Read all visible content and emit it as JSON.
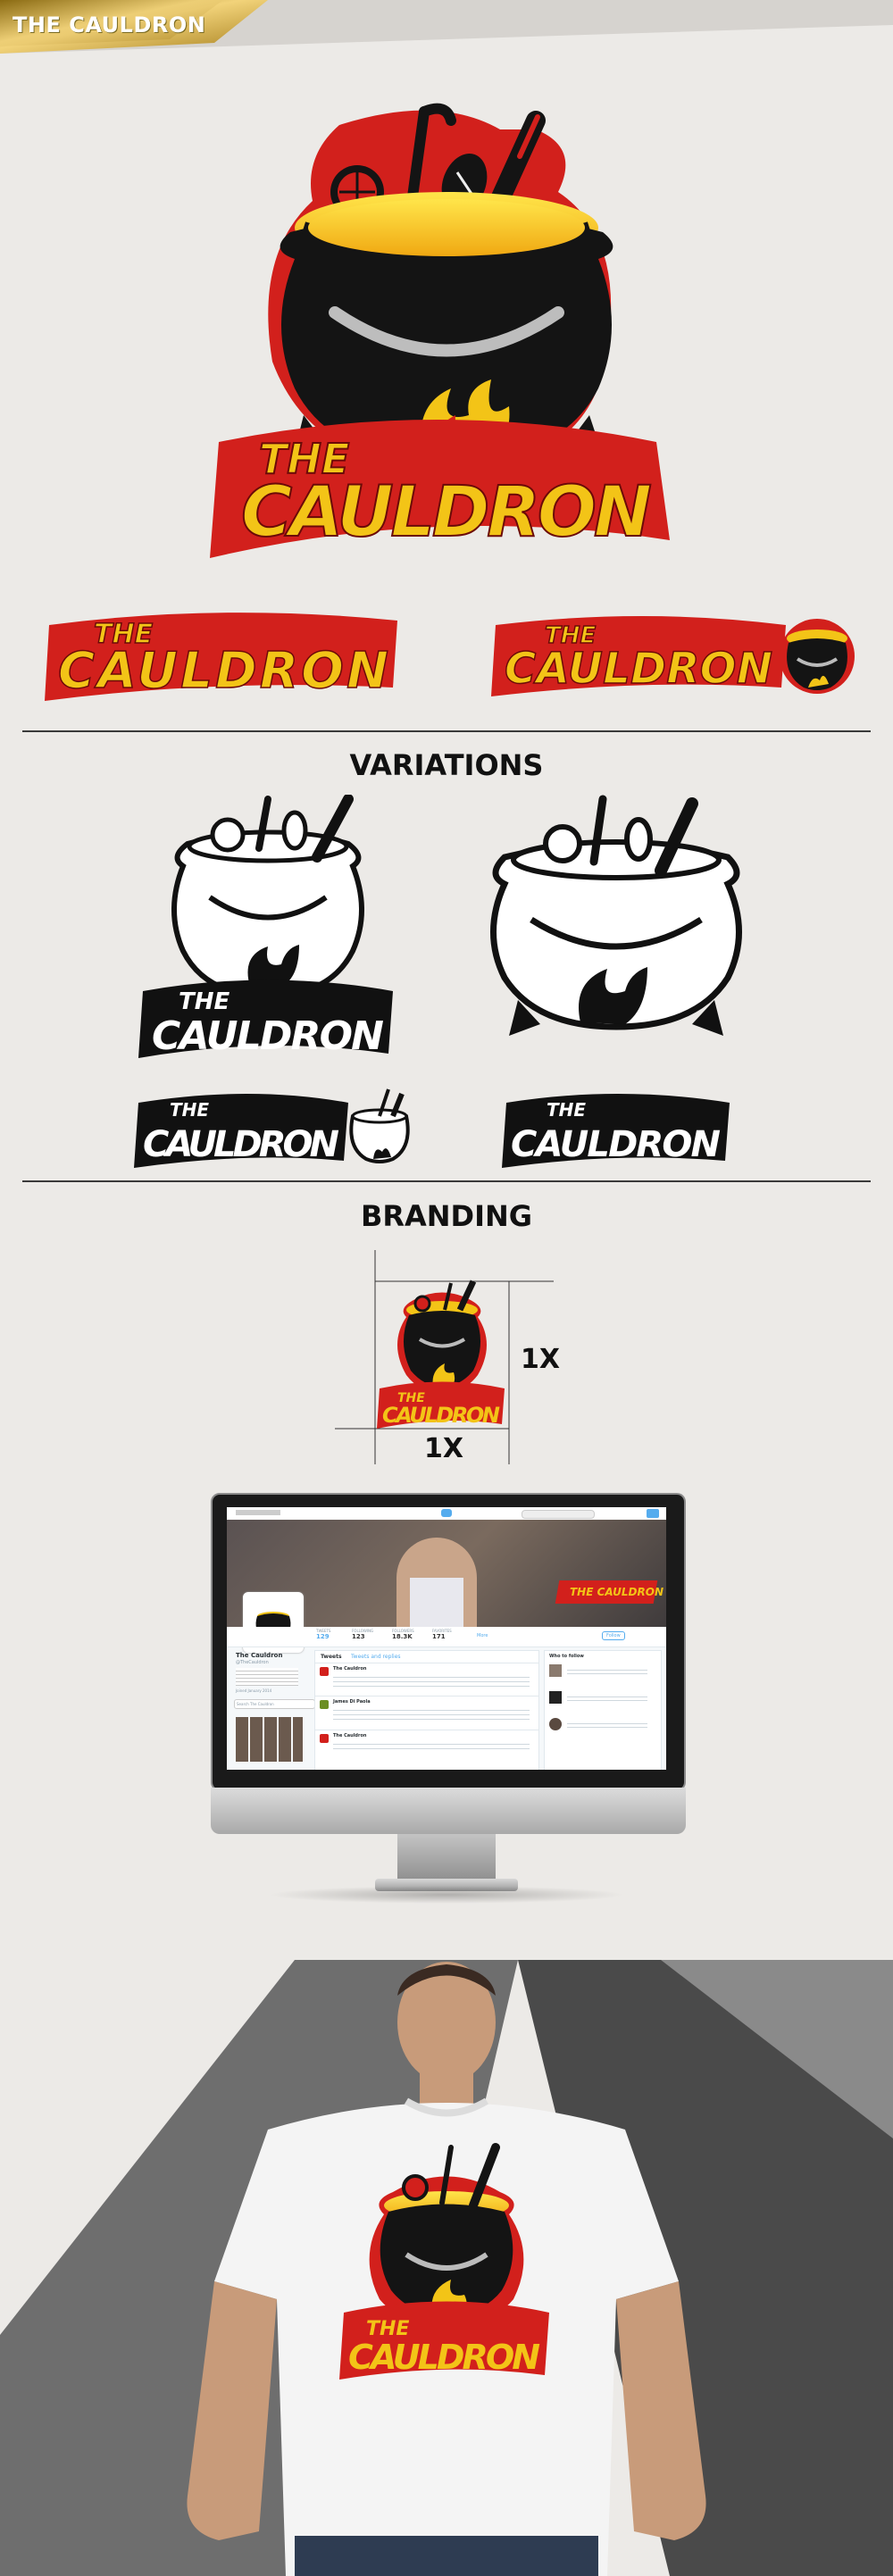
{
  "header": {
    "title": "THE CAULDRON"
  },
  "sections": {
    "variations": "VARIATIONS",
    "branding": "BRANDING"
  },
  "branding": {
    "width_label": "1X",
    "height_label": "1X"
  },
  "logo": {
    "word_the": "THE",
    "word_cauldron": "CAULDRON"
  },
  "twitter": {
    "profile_name": "The Cauldron",
    "handle": "@TheCauldron",
    "header_logo": "THE CAULDRON",
    "tabs": [
      "Tweets",
      "Tweets and replies"
    ],
    "stats": [
      {
        "label": "TWEETS",
        "value": "129"
      },
      {
        "label": "FOLLOWING",
        "value": "123"
      },
      {
        "label": "FOLLOWERS",
        "value": "18.3K"
      },
      {
        "label": "FAVORITES",
        "value": "171"
      }
    ],
    "follow_button": "Follow",
    "more_label": "More",
    "who_to_follow": "Who to follow",
    "search_placeholder": "Search The Cauldron",
    "timeline_author": "The Cauldron",
    "timeline_author_2": "James Di Paola",
    "bio_joined": "Joined January 2014"
  },
  "colors": {
    "gold": "#d4a62a",
    "red": "#d2201c",
    "yellow": "#f3c417",
    "pot": "#141414",
    "twitter_blue": "#55acee"
  }
}
